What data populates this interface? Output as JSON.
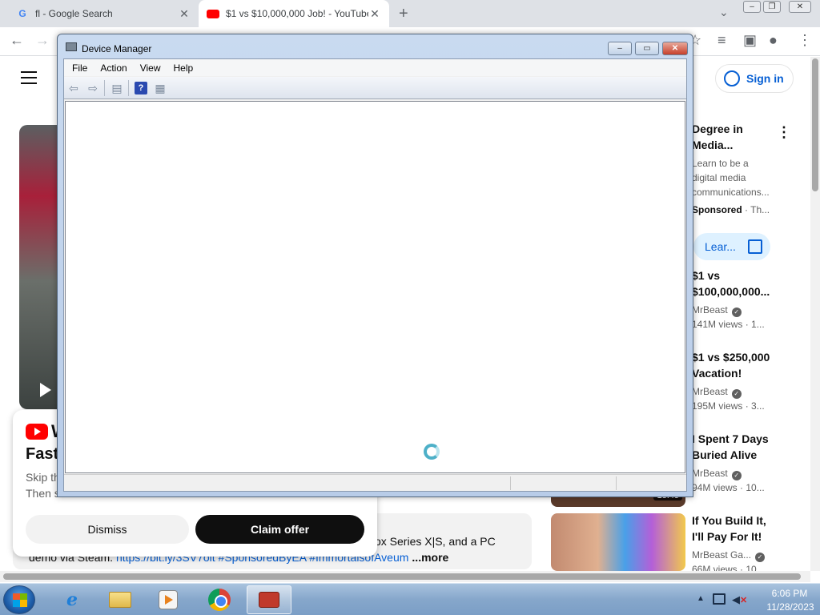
{
  "browser": {
    "tabs": [
      {
        "title": "fl - Google Search",
        "favicon": "google-icon"
      },
      {
        "title": "$1 vs $10,000,000 Job! - YouTube",
        "favicon": "youtube-icon"
      }
    ],
    "new_tab": "+",
    "close_glyph": "✕"
  },
  "youtube": {
    "signin_label": "Sign in",
    "ad": {
      "title_line1": "W",
      "title_line2": "Fast",
      "sub_line1": "Skip th",
      "sub_line2": "Then s",
      "dismiss_label": "Dismiss",
      "claim_label": "Claim offer"
    },
    "description": {
      "line1": "ox Series X|S, and a PC",
      "line2_prefix": "demo via Steam. ",
      "line2_link": "https://bit.ly/3SV7oit #SponsoredByEA #ImmortalsofAveum",
      "more": "...more"
    },
    "sidebar": [
      {
        "title1": "Degree in",
        "title2": "Media...",
        "line1": "Learn to be a",
        "line2": "digital media",
        "line3": "communications...",
        "line4_bold": "Sponsored",
        "line4_rest": " · Th..."
      },
      {
        "title1": "$1 vs",
        "title2": "$100,000,000...",
        "channel": "MrBeast",
        "meta": "141M views · 1..."
      },
      {
        "title1": "$1 vs $250,000",
        "title2": "Vacation!",
        "channel": "MrBeast",
        "meta": "195M views · 3..."
      },
      {
        "title1": "I Spent 7 Days",
        "title2": "Buried Alive",
        "channel": "MrBeast",
        "meta": "94M views · 10..."
      },
      {
        "title1": "If You Build It,",
        "title2": "I'll Pay For It!",
        "channel": "MrBeast Ga...",
        "meta": "66M views · 10..."
      }
    ],
    "learn_label": "Lear...",
    "thumb1_duration": "18:45"
  },
  "device_manager": {
    "title": "Device Manager",
    "menu": [
      "File",
      "Action",
      "View",
      "Help"
    ],
    "toolbar": [
      "back-icon",
      "forward-icon",
      "show-hide-console-tree-icon",
      "help-icon",
      "properties-icon"
    ],
    "loading": true
  },
  "taskbar": {
    "items": [
      "internet-explorer",
      "windows-explorer",
      "media-player",
      "google-chrome",
      "device-manager"
    ],
    "active": "device-manager",
    "clock_time": "6:06 PM",
    "clock_date": "11/28/2023"
  },
  "colors": {
    "youtube_red": "#ff0000",
    "youtube_blue": "#065fd4",
    "taskbar": "#86a7cb",
    "window_frame": "#c9daf0"
  }
}
